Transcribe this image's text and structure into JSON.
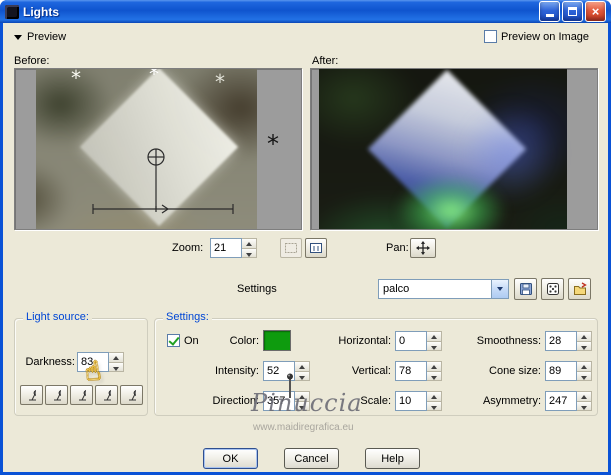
{
  "window": {
    "title": "Lights"
  },
  "icons": {
    "close": "×",
    "hand_cursor": "☝",
    "light_marker": "*"
  },
  "preview_bar": {
    "preview": "Preview",
    "preview_on_image": "Preview on Image"
  },
  "panes": {
    "before": "Before:",
    "after": "After:"
  },
  "zoom": {
    "label": "Zoom:",
    "value": "21"
  },
  "pan": {
    "label": "Pan:"
  },
  "presets": {
    "label": "Settings",
    "value": "palco"
  },
  "light_source": {
    "title": "Light source:",
    "darkness_label": "Darkness:",
    "darkness_value": "83"
  },
  "settings": {
    "title": "Settings:",
    "on_label": "On",
    "color_label": "Color:",
    "color_value": "#0E9B0E",
    "intensity_label": "Intensity:",
    "intensity_value": "52",
    "direction_label": "Direction:",
    "direction_value": "357",
    "horizontal_label": "Horizontal:",
    "horizontal_value": "0",
    "vertical_label": "Vertical:",
    "vertical_value": "78",
    "scale_label": "Scale:",
    "scale_value": "10",
    "smoothness_label": "Smoothness:",
    "smoothness_value": "28",
    "cone_size_label": "Cone size:",
    "cone_size_value": "89",
    "asymmetry_label": "Asymmetry:",
    "asymmetry_value": "247"
  },
  "watermark": {
    "name": "Pinuccia",
    "site": "www.maidiregrafica.eu"
  },
  "actions": {
    "ok": "OK",
    "cancel": "Cancel",
    "help": "Help"
  },
  "colors": {
    "titlebar": "#0F54CE",
    "dialog_bg": "#ECE9D8",
    "group_caption": "#0046D5"
  }
}
